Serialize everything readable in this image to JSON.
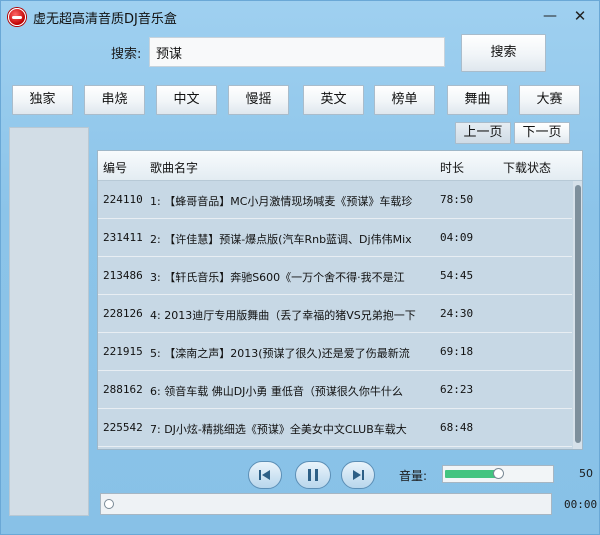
{
  "window": {
    "title": "虚无超高清音质DJ音乐盒",
    "minimize": "—",
    "close": "✕"
  },
  "search": {
    "label": "搜索:",
    "value": "预谋",
    "button": "搜索"
  },
  "categories": [
    "独家",
    "串烧",
    "中文",
    "慢摇",
    "英文",
    "榜单",
    "舞曲",
    "大赛"
  ],
  "paging": {
    "prev": "上一页",
    "next": "下一页"
  },
  "table": {
    "columns": [
      "编号",
      "歌曲名字",
      "时长",
      "下载状态"
    ],
    "rows": [
      {
        "id": "224110",
        "name": "1: 【蜂哥音品】MC小月激情现场喊麦《预谋》车载珍",
        "duration": "78:50",
        "status": ""
      },
      {
        "id": "231411",
        "name": "2: 【许佳慧】预谋-爆点版(汽车Rnb蓝调、Dj伟伟Mix",
        "duration": "04:09",
        "status": ""
      },
      {
        "id": "213486",
        "name": "3: 【轩氏音乐】奔驰S600《一万个舍不得·我不是江",
        "duration": "54:45",
        "status": ""
      },
      {
        "id": "228126",
        "name": "4: 2013迪厅专用版舞曲（丢了幸福的猪VS兄弟抱一下",
        "duration": "24:30",
        "status": ""
      },
      {
        "id": "221915",
        "name": "5: 【滦南之声】2013(预谋了很久)还是爱了伤最新流",
        "duration": "69:18",
        "status": ""
      },
      {
        "id": "288162",
        "name": "6: 领音车载 佛山DJ小勇 重低音（预谋很久你牛什么",
        "duration": "62:23",
        "status": ""
      },
      {
        "id": "225542",
        "name": "7: DJ小炫-精挑细选《预谋》全美女中文CLUB车载大",
        "duration": "68:48",
        "status": ""
      }
    ]
  },
  "player": {
    "volume_label": "音量:",
    "volume_value": "50",
    "volume_fraction": 0.5,
    "progress_fraction": 0.0,
    "time": "00:00"
  },
  "icons": {
    "prev": "skip-back-icon",
    "play": "pause-icon",
    "next": "skip-forward-icon"
  },
  "colors": {
    "background": "#8cc4e9",
    "volume_fill": "#43c480"
  }
}
